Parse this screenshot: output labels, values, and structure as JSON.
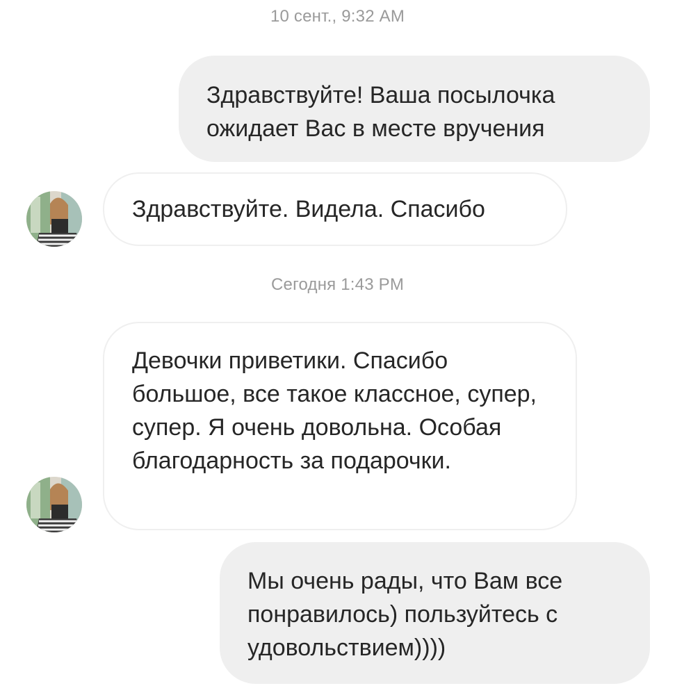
{
  "conversation": {
    "timestamps": [
      "10 сент., 9:32 AM",
      "Сегодня 1:43 PM"
    ],
    "messages": [
      {
        "direction": "outgoing",
        "text": "Здравствуйте! Ваша посылочка ожидает Вас в месте вручения"
      },
      {
        "direction": "incoming",
        "text": "Здравствуйте. Видела. Спасибо"
      },
      {
        "direction": "incoming",
        "text": "Девочки приветики. Спасибо большое, все такое классное, супер, супер. Я очень довольна. Особая благодарность за подарочки."
      },
      {
        "direction": "outgoing",
        "text": "Мы очень рады, что Вам все понравилось) пользуйтесь с удовольствием))))"
      }
    ]
  },
  "colors": {
    "outgoing_bubble": "#efefef",
    "incoming_border": "#efefef",
    "timestamp_text": "#9a9a9a",
    "message_text": "#262626"
  },
  "icons": {
    "avatar": "contact-avatar-photo"
  }
}
